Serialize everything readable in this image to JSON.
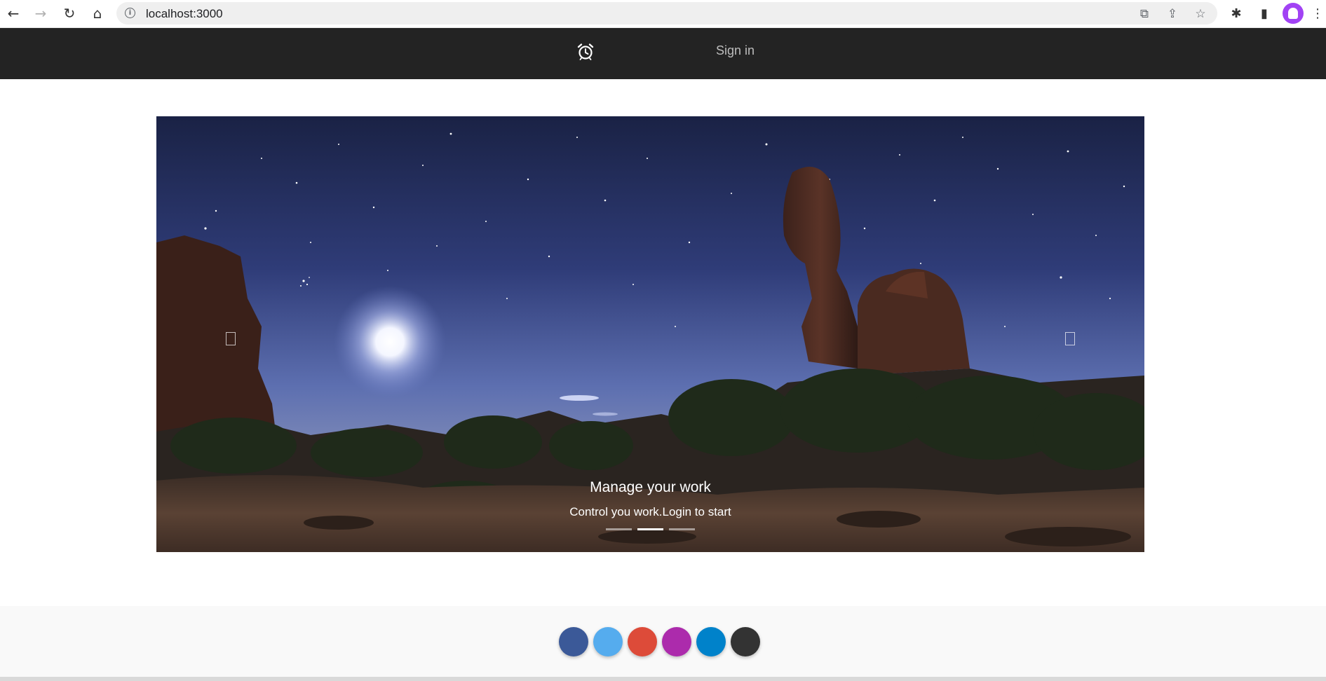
{
  "browser": {
    "url": "localhost:3000",
    "back_icon": "←",
    "forward_icon": "→",
    "reload_icon": "↻",
    "home_icon": "⌂",
    "info_icon": "i",
    "translate_icon": "⧉",
    "share_icon": "⇪",
    "bookmark_icon": "☆",
    "extensions_icon": "✱",
    "sidepanel_icon": "▮",
    "menu_icon": "⋮"
  },
  "header": {
    "logo_icon": "alarm-clock",
    "sign_in_label": "Sign in",
    "background": "#232323"
  },
  "carousel": {
    "caption_title": "Manage your work",
    "caption_text": "Control you work.Login to start",
    "active_index": 1,
    "slide_count": 3
  },
  "footer": {
    "social_colors": [
      "#3b5998",
      "#55acee",
      "#dd4b39",
      "#ac2bac",
      "#0082ca",
      "#333333"
    ]
  }
}
